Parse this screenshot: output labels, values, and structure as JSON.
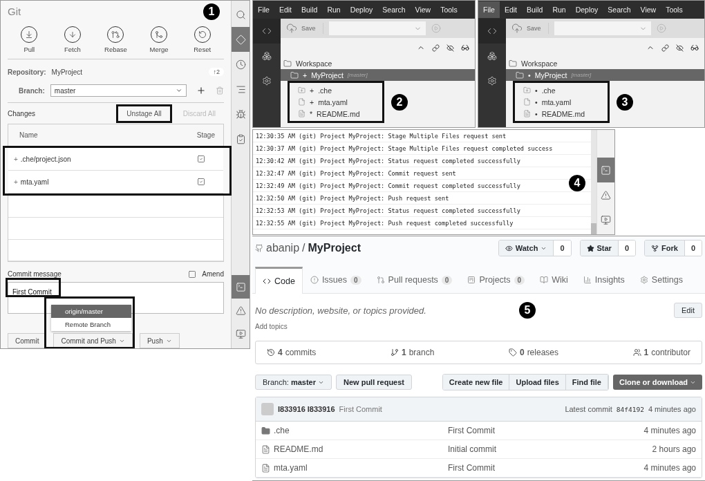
{
  "git_panel": {
    "title": "Git",
    "callout": "1",
    "actions": [
      {
        "label": "Pull",
        "kind": "pull"
      },
      {
        "label": "Fetch",
        "kind": "fetch"
      },
      {
        "label": "Rebase",
        "kind": "rebase"
      },
      {
        "label": "Merge",
        "kind": "merge"
      },
      {
        "label": "Reset",
        "kind": "reset"
      }
    ],
    "repository_label": "Repository:",
    "repository": "MyProject",
    "ahead": "↑2",
    "branch_label": "Branch:",
    "branch": "master",
    "changes_label": "Changes",
    "unstage_all": "Unstage All",
    "discard_all": {
      "label": "Discard All",
      "disabled": true
    },
    "columns": [
      "Name",
      "Stage"
    ],
    "files": [
      {
        "status": "+",
        "name": ".che/project.json",
        "staged": true
      },
      {
        "status": "+",
        "name": "mta.yaml",
        "staged": true
      }
    ],
    "commit_label": "Commit message",
    "amend": {
      "label": "Amend",
      "checked": false
    },
    "commit_message": "First Commit",
    "menu": [
      {
        "label": "origin/master",
        "selected": true
      },
      {
        "label": "Remote Branch",
        "selected": false
      }
    ],
    "buttons": [
      {
        "label": "Commit",
        "dropdown": false
      },
      {
        "label": "Commit and Push",
        "dropdown": true
      },
      {
        "label": "Push",
        "dropdown": true
      }
    ],
    "sidebar": {
      "top": [
        {
          "kind": "search",
          "selected": false
        },
        {
          "kind": "git",
          "selected": true
        },
        {
          "kind": "history",
          "selected": false
        },
        {
          "kind": "outline",
          "selected": false
        },
        {
          "kind": "debug",
          "selected": false
        },
        {
          "kind": "tasks",
          "selected": false
        }
      ],
      "bottom": [
        {
          "kind": "console",
          "selected": true
        },
        {
          "kind": "problems",
          "selected": false
        },
        {
          "kind": "preview",
          "selected": false
        }
      ]
    }
  },
  "ide_panels": [
    {
      "callout": "2",
      "menu": [
        {
          "label": "File",
          "selected": false
        },
        {
          "label": "Edit",
          "selected": false
        },
        {
          "label": "Build",
          "selected": false
        },
        {
          "label": "Run",
          "selected": false
        },
        {
          "label": "Deploy",
          "selected": false
        },
        {
          "label": "Search",
          "selected": false
        },
        {
          "label": "View",
          "selected": false
        },
        {
          "label": "Tools",
          "selected": false
        }
      ],
      "save": "Save",
      "workspace": "Workspace",
      "project": {
        "marker": "+",
        "name": "MyProject",
        "branch": "[master]"
      },
      "files": [
        {
          "kind": "folder",
          "marker": "+",
          "name": ".che"
        },
        {
          "kind": "file",
          "marker": "+",
          "name": "mta.yaml"
        },
        {
          "kind": "doc",
          "marker": "*",
          "name": "README.md"
        }
      ]
    },
    {
      "callout": "3",
      "menu": [
        {
          "label": "File",
          "selected": true
        },
        {
          "label": "Edit",
          "selected": false
        },
        {
          "label": "Build",
          "selected": false
        },
        {
          "label": "Run",
          "selected": false
        },
        {
          "label": "Deploy",
          "selected": false
        },
        {
          "label": "Search",
          "selected": false
        },
        {
          "label": "View",
          "selected": false
        },
        {
          "label": "Tools",
          "selected": false
        }
      ],
      "save": "Save",
      "workspace": "Workspace",
      "project": {
        "marker": "•",
        "name": "MyProject",
        "branch": "[master]"
      },
      "files": [
        {
          "kind": "folder",
          "marker": "•",
          "name": ".che"
        },
        {
          "kind": "file",
          "marker": "•",
          "name": "mta.yaml"
        },
        {
          "kind": "doc",
          "marker": "•",
          "name": "README.md"
        }
      ]
    }
  ],
  "log": {
    "callout": "4",
    "lines": [
      "12:30:35 AM (git) Project MyProject: Stage Multiple Files request sent",
      "12:30:37 AM (git) Project MyProject: Stage Multiple Files request completed success",
      "12:30:42 AM (git) Project MyProject: Status request completed successfully",
      "12:32:47 AM (git) Project MyProject: Commit request sent",
      "12:32:49 AM (git) Project MyProject: Commit request completed successfully",
      "12:32:50 AM (git) Project MyProject: Push request sent",
      "12:32:53 AM (git) Project MyProject: Status request completed successfully",
      "12:32:55 AM (git) Project MyProject: Push request completed successfully"
    ],
    "sidebar": [
      {
        "kind": "console",
        "selected": true
      },
      {
        "kind": "problems",
        "selected": false
      },
      {
        "kind": "preview",
        "selected": false
      }
    ]
  },
  "github": {
    "callout": "5",
    "owner": "abanip",
    "separator": "/",
    "repo": "MyProject",
    "counters": [
      {
        "kind": "watch",
        "label": "Watch",
        "dropdown": true,
        "count": "0"
      },
      {
        "kind": "star",
        "label": "Star",
        "dropdown": false,
        "count": "0"
      },
      {
        "kind": "fork",
        "label": "Fork",
        "dropdown": false,
        "count": "0"
      }
    ],
    "tabs": [
      {
        "kind": "code",
        "label": "Code",
        "selected": true
      },
      {
        "kind": "issues",
        "label": "Issues",
        "count": "0",
        "selected": false
      },
      {
        "kind": "pulls",
        "label": "Pull requests",
        "count": "0",
        "selected": false
      },
      {
        "kind": "projects",
        "label": "Projects",
        "count": "0",
        "selected": false
      },
      {
        "kind": "wiki",
        "label": "Wiki",
        "selected": false
      },
      {
        "kind": "insights",
        "label": "Insights",
        "selected": false
      },
      {
        "kind": "settings",
        "label": "Settings",
        "selected": false
      }
    ],
    "description": "No description, website, or topics provided.",
    "edit": "Edit",
    "add_topics": "Add topics",
    "summary": [
      {
        "kind": "commits",
        "count": "4",
        "label": "commits"
      },
      {
        "kind": "branch",
        "count": "1",
        "label": "branch"
      },
      {
        "kind": "releases",
        "count": "0",
        "label": "releases"
      },
      {
        "kind": "contributors",
        "count": "1",
        "label": "contributor"
      }
    ],
    "branch_label": "Branch:",
    "branch": "master",
    "new_pr": "New pull request",
    "file_buttons": [
      "Create new file",
      "Upload files",
      "Find file"
    ],
    "clone": "Clone or download",
    "commit": {
      "author": "I833916 I833916",
      "message": "First Commit",
      "latest": "Latest commit",
      "sha": "84f4192",
      "time": "4 minutes ago"
    },
    "files": [
      {
        "kind": "folder",
        "name": ".che",
        "message": "First Commit",
        "time": "4 minutes ago"
      },
      {
        "kind": "file",
        "name": "README.md",
        "message": "Initial commit",
        "time": "2 hours ago"
      },
      {
        "kind": "file",
        "name": "mta.yaml",
        "message": "First Commit",
        "time": "4 minutes ago"
      }
    ]
  }
}
